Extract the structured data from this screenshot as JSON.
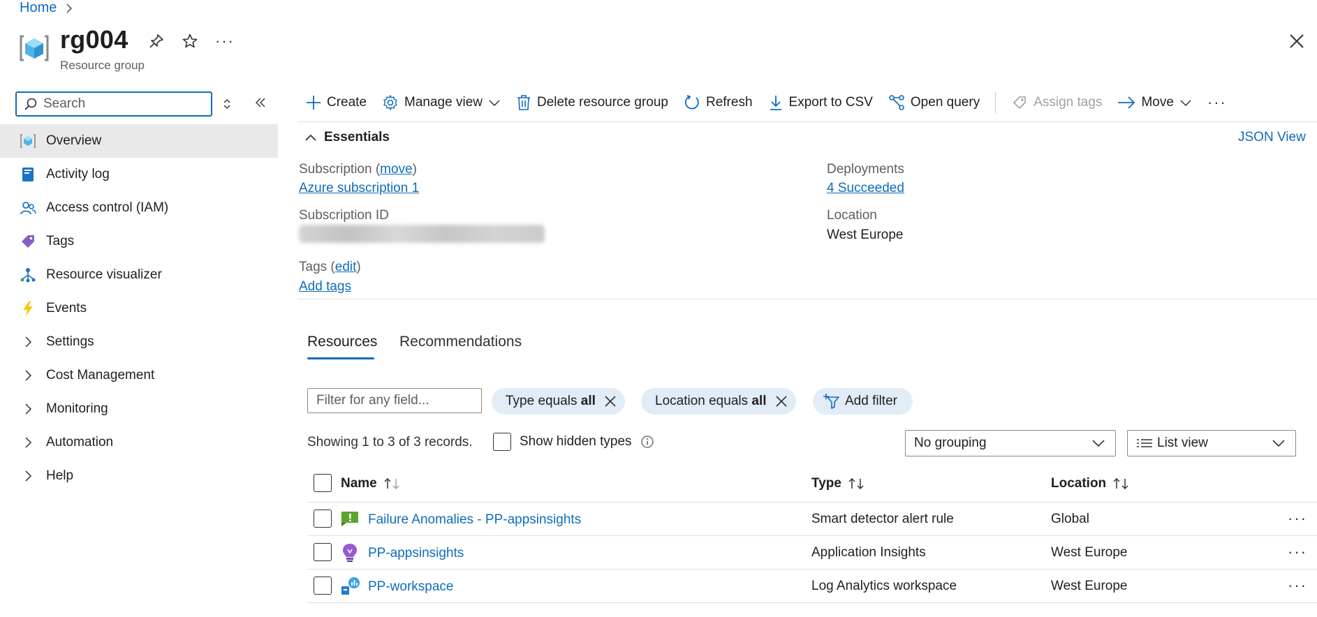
{
  "breadcrumb": {
    "home": "Home"
  },
  "header": {
    "title": "rg004",
    "subtitle": "Resource group",
    "more": "···"
  },
  "sidebar": {
    "search_placeholder": "Search",
    "items": [
      {
        "label": "Overview",
        "icon": "resource-group-icon",
        "active": true
      },
      {
        "label": "Activity log",
        "icon": "activity-log-icon"
      },
      {
        "label": "Access control (IAM)",
        "icon": "people-icon"
      },
      {
        "label": "Tags",
        "icon": "tag-icon"
      },
      {
        "label": "Resource visualizer",
        "icon": "visualizer-icon"
      },
      {
        "label": "Events",
        "icon": "lightning-icon"
      },
      {
        "label": "Settings",
        "icon": "chevron-right-icon"
      },
      {
        "label": "Cost Management",
        "icon": "chevron-right-icon"
      },
      {
        "label": "Monitoring",
        "icon": "chevron-right-icon"
      },
      {
        "label": "Automation",
        "icon": "chevron-right-icon"
      },
      {
        "label": "Help",
        "icon": "chevron-right-icon"
      }
    ]
  },
  "toolbar": {
    "create": "Create",
    "manage_view": "Manage view",
    "delete": "Delete resource group",
    "refresh": "Refresh",
    "export": "Export to CSV",
    "open_query": "Open query",
    "assign_tags": "Assign tags",
    "move": "Move",
    "more": "···"
  },
  "essentials": {
    "title": "Essentials",
    "json_view": "JSON View",
    "subscription_label": "Subscription",
    "move_link": "move",
    "subscription_value": "Azure subscription 1",
    "subscription_id_label": "Subscription ID",
    "tags_label": "Tags",
    "edit_link": "edit",
    "add_tags": "Add tags",
    "deployments_label": "Deployments",
    "deployments_value": "4 Succeeded",
    "location_label": "Location",
    "location_value": "West Europe"
  },
  "tabs": {
    "resources": "Resources",
    "recommendations": "Recommendations"
  },
  "filters": {
    "placeholder": "Filter for any field...",
    "type_prefix": "Type equals ",
    "type_value": "all",
    "location_prefix": "Location equals ",
    "location_value": "all",
    "add_filter": "Add filter"
  },
  "summary": {
    "records": "Showing 1 to 3 of 3 records.",
    "show_hidden": "Show hidden types",
    "grouping": "No grouping",
    "view": "List view"
  },
  "table": {
    "headers": {
      "name": "Name",
      "type": "Type",
      "location": "Location"
    },
    "rows": [
      {
        "name": "Failure Anomalies - PP-appsinsights",
        "type": "Smart detector alert rule",
        "location": "Global",
        "icon": "alert-rule-icon"
      },
      {
        "name": "PP-appsinsights",
        "type": "Application Insights",
        "location": "West Europe",
        "icon": "app-insights-icon"
      },
      {
        "name": "PP-workspace",
        "type": "Log Analytics workspace",
        "location": "West Europe",
        "icon": "log-analytics-icon"
      }
    ],
    "row_more": "···"
  },
  "colors": {
    "accent": "#0f6cbd",
    "pill_bg": "#e1ecf7",
    "active_nav": "#e9e9e9"
  }
}
